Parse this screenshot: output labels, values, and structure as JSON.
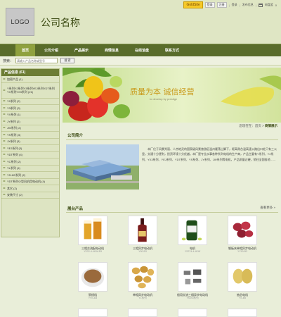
{
  "header": {
    "logo": "LOGO",
    "company_name": "公司名称",
    "topbar": {
      "goldsite": "GoldSite",
      "btn_login": "登录",
      "btn_register": "注册",
      "link_login": "登录",
      "link_post": "发布信息",
      "link_cart": "询盘篮",
      "cart_count": "0"
    }
  },
  "nav": {
    "items": [
      {
        "label": "首页"
      },
      {
        "label": "公司介绍"
      },
      {
        "label": "产品展示"
      },
      {
        "label": "商情信息"
      },
      {
        "label": "在线洽盘"
      },
      {
        "label": "联系方式"
      }
    ]
  },
  "search": {
    "label": "搜索：",
    "placeholder": "请输入产品名称或型号",
    "button": "搜 索"
  },
  "sidebar": {
    "title": "产品信息 (61)",
    "categories": [
      {
        "label": "加密产品 (1)"
      },
      {
        "label": "Y系列Y2系列Y3系列YEJ系列YDT系列YX系列YX3系列 (21)"
      },
      {
        "label": "Y2系列 (2)"
      },
      {
        "label": "Y3系列 (3)"
      },
      {
        "label": "YX系列 (1)"
      },
      {
        "label": "JY系列 (2)"
      },
      {
        "label": "JW系列 (2)"
      },
      {
        "label": "YS系列 (3)"
      },
      {
        "label": "JX系列 (3)"
      },
      {
        "label": "YEJ系列 (3)"
      },
      {
        "label": "YDT系列 (4)"
      },
      {
        "label": "YC系列 (2)"
      },
      {
        "label": "YL系列 (4)"
      },
      {
        "label": "YS-KE系列 (2)"
      },
      {
        "label": "YDT系列小型风机用电动机 (4)"
      },
      {
        "label": "其它 (2)"
      },
      {
        "label": "安装尺寸 (2)"
      }
    ]
  },
  "banner": {
    "slogan": "质量为本  诚信经营",
    "subtitle": "to develop by prestige"
  },
  "breadcrumb": {
    "prefix": "您现在在：",
    "home": "首页",
    "sep": " > ",
    "current": "商情展示"
  },
  "intro": {
    "title": "公司简介",
    "text": "本厂位于风景秀丽、人杰地灵的国家级风景旅游区温州雁荡山脚下，距离甬台温高速公路出口处只有三公里，交通十分便利，投资环境十分优越。本厂是专业从事各种系列电机的生产商，产品主要有Y系列、Y2系列、YX3系列、YEJ系列、YDT系列、YS系列、JY系列、JW系列等电机，产品质量过硬，销往全国各地……"
  },
  "products": {
    "title": "展台产品",
    "more": "查看更多 »",
    "items": [
      {
        "name": "三相交流配电动机",
        "model": "Y2S2-4-4KW-B3",
        "icon": "beer-glass-icon"
      },
      {
        "name": "三相异步电动机",
        "model": "Y90-B3",
        "icon": "wine-bottle-icon"
      },
      {
        "name": "电机",
        "model": "Y2S74-4-4KW",
        "icon": "capsule-bottle-icon"
      },
      {
        "name": "钢板夹单相异步电动机",
        "model": "YY90-B3",
        "icon": "red-berries-icon"
      },
      {
        "name": "铜线机",
        "model": "YVS-B3",
        "icon": "powder-plate-icon"
      },
      {
        "name": "单相异步电动机",
        "model": "YL系列",
        "icon": "mushrooms-icon"
      },
      {
        "name": "船用交流三相异步电动机",
        "model": "YS-B3系列",
        "icon": "tool-parts-icon"
      },
      {
        "name": "抽芯电机",
        "model": "YS-B5",
        "icon": "potatoes-icon"
      }
    ]
  },
  "colors": {
    "nav_bg": "#596c2b",
    "nav_active": "#8fa13f",
    "sidebar_head": "#6d7d35",
    "title_green": "#3b4a12"
  }
}
